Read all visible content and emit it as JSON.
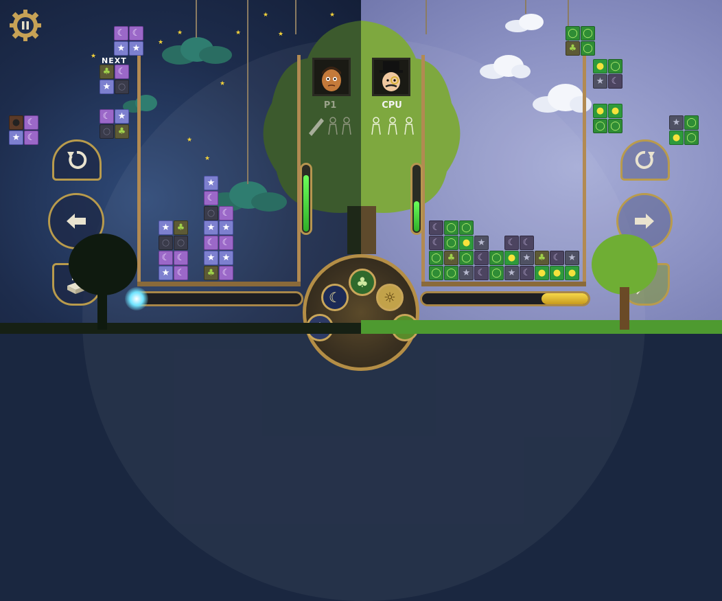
{
  "hud": {
    "next_label": "NEXT",
    "player1_label": "P1",
    "cpu_label": "CPU"
  },
  "colors": {
    "night_bg": "#1d2c4c",
    "day_bg": "#8a90c2",
    "frame": "#b28a52",
    "meter_fill": "#3fd632"
  },
  "icons": {
    "pause": "pause-gear-icon",
    "rotate": "rotate-icon",
    "move_left": "arrow-left-icon",
    "move_right": "arrow-right-icon",
    "drop": "brick-drop-icon",
    "power": "feather-icon",
    "moon_gem": "moon",
    "star_gem": "star",
    "leaf_gem": "leaf",
    "sun_gem": "sun",
    "ring_gem": "ring"
  },
  "meters": {
    "player1_level": 0.85,
    "cpu_level": 0.45
  },
  "attack_bar": {
    "player1_charge": 0.03,
    "cpu_charge": 0.28
  }
}
